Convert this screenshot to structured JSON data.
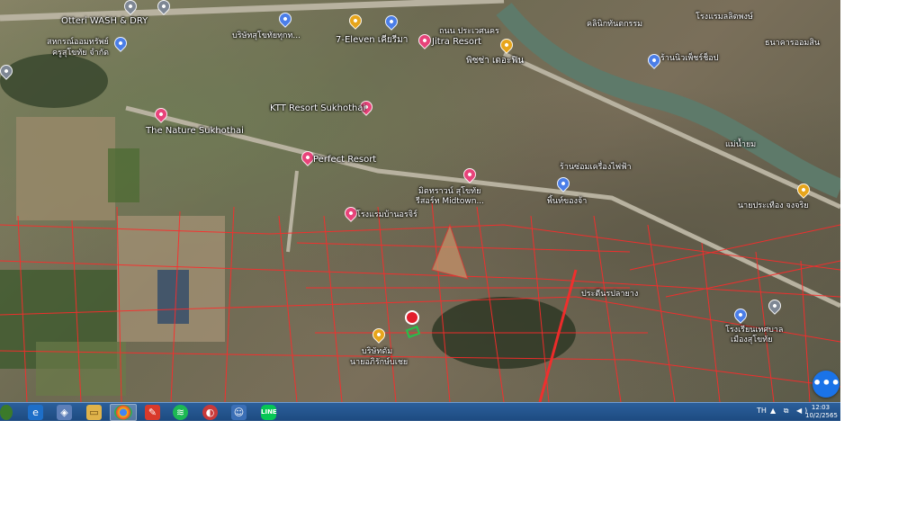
{
  "map": {
    "labels": {
      "l1": "Otteri WASH & DRY",
      "l2": "7-Eleven เคียรีมา",
      "l3": "Jitra Resort",
      "l4": "พิซซ่า เดอะฟิน",
      "l5": "KTT Resort Sukhothai",
      "l6": "The Nature Sukhothai",
      "l7": "Perfect Resort",
      "l8": "โรงแรมบ้านอรจิร์",
      "l9": "มิตทราวน์ สุโขทัย",
      "l10": "รีสอร์ท Midtown...",
      "l11": "พิ้นท์ของจ้า",
      "l12": "ประตีนรปลายาง",
      "l13": "โรงเรียนเทศบาล",
      "l14": "เมืองสุโขทัย",
      "l15": "บริษัทดัม",
      "l16": "นายอภิรักษ์บเชย",
      "l17": "ร้านซ่อมเครื่องไฟฟ้า",
      "l18": "นายประเทือง จงจริย",
      "l19": "โรงแรมลลิตพงษ์",
      "l20": "ร้านนิวเพ็ชร์ช็อป",
      "l21": "ธนาคารออมสิน",
      "l22": "สหกรณ์ออมทรัพย์",
      "l23": "ครูสุโขทัย จำกัด",
      "l24": "แม่น้ำยม",
      "l25": "ถนน ประเวศนคร",
      "l26": "คลินิกทันตกรรม",
      "l27": "บริษัทสุโขทัยทุกท..."
    },
    "fab_label": "•••"
  },
  "taskbar": {
    "line_label": "LINE",
    "lang": "TH",
    "tray": "▲ ⧉ ◀)",
    "time": "12:03",
    "date": "10/2/2565"
  }
}
